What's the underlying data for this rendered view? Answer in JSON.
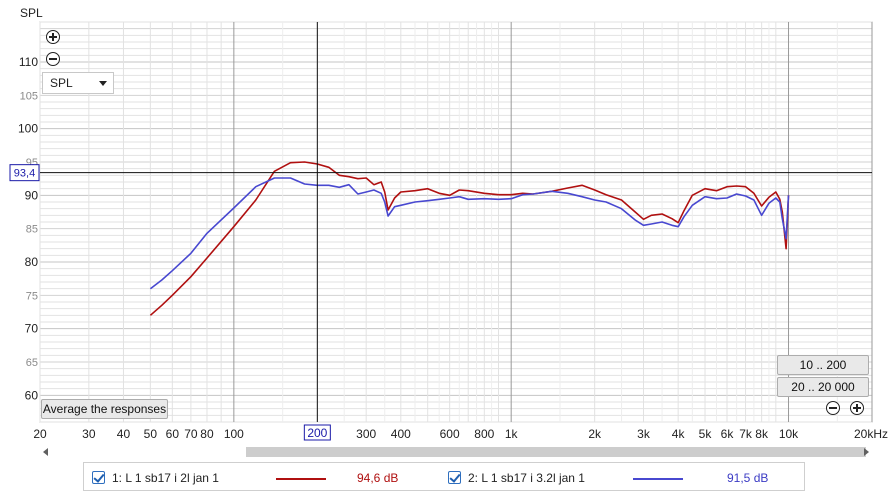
{
  "colors": {
    "series1": "#b01010",
    "series2": "#4848d0",
    "cursor": "#1a1aa8",
    "grid_major": "#c4c4c4",
    "grid_minor": "#e2e2e2"
  },
  "controls": {
    "select_value": "SPL",
    "average_button": "Average the responses",
    "range_button_1": "10 .. 200",
    "range_button_2": "20 .. 20 000",
    "zoom_in_icon": "plus-circle-icon",
    "zoom_out_icon": "minus-circle-icon"
  },
  "legend": [
    {
      "label": "1: L 1 sb17 i 2l jan 1",
      "value": "94,6 dB",
      "checked": true
    },
    {
      "label": "2: L 1 sb17 i 3.2l jan 1",
      "value": "91,5 dB",
      "checked": true
    }
  ],
  "chart_data": {
    "type": "line",
    "ylabel": "SPL",
    "xlabel": "",
    "x_scale": "log",
    "xlim": [
      20,
      20000
    ],
    "ylim": [
      56,
      116
    ],
    "grid": true,
    "y_ticks": [
      "60",
      "65",
      "70",
      "75",
      "80",
      "85",
      "90",
      "95",
      "100",
      "105",
      "110"
    ],
    "y_ticks_major": [
      60,
      70,
      80,
      90,
      100,
      110
    ],
    "x_ticks": [
      {
        "v": 20,
        "label": "20"
      },
      {
        "v": 30,
        "label": "30"
      },
      {
        "v": 40,
        "label": "40"
      },
      {
        "v": 50,
        "label": "50"
      },
      {
        "v": 60,
        "label": "60"
      },
      {
        "v": 70,
        "label": "70"
      },
      {
        "v": 80,
        "label": "80"
      },
      {
        "v": 100,
        "label": "100"
      },
      {
        "v": 200,
        "label": "200"
      },
      {
        "v": 300,
        "label": "300"
      },
      {
        "v": 400,
        "label": "400"
      },
      {
        "v": 600,
        "label": "600"
      },
      {
        "v": 800,
        "label": "800"
      },
      {
        "v": 1000,
        "label": "1k"
      },
      {
        "v": 2000,
        "label": "2k"
      },
      {
        "v": 3000,
        "label": "3k"
      },
      {
        "v": 4000,
        "label": "4k"
      },
      {
        "v": 5000,
        "label": "5k"
      },
      {
        "v": 6000,
        "label": "6k"
      },
      {
        "v": 7000,
        "label": "7k"
      },
      {
        "v": 8000,
        "label": "8k"
      },
      {
        "v": 10000,
        "label": "10k"
      },
      {
        "v": 20000,
        "label": "20kHz"
      }
    ],
    "cursor": {
      "x": 200,
      "y": 93.4,
      "x_label": "200",
      "y_label": "93,4"
    },
    "series": [
      {
        "name": "1: L 1 sb17 i 2l jan 1",
        "x": [
          50,
          55,
          60,
          70,
          80,
          100,
          120,
          140,
          160,
          180,
          200,
          220,
          240,
          260,
          280,
          300,
          320,
          340,
          350,
          360,
          380,
          400,
          450,
          500,
          550,
          600,
          650,
          700,
          800,
          900,
          1000,
          1100,
          1200,
          1400,
          1600,
          1800,
          2000,
          2200,
          2500,
          2800,
          3000,
          3200,
          3500,
          3800,
          4000,
          4200,
          4500,
          5000,
          5500,
          6000,
          6500,
          7000,
          7500,
          8000,
          8500,
          9000,
          9300,
          9500,
          9800,
          10000
        ],
        "y": [
          72,
          73.5,
          75,
          77.8,
          80.6,
          85.3,
          89.3,
          93.6,
          94.9,
          95,
          94.7,
          94.2,
          93,
          92.8,
          92.5,
          92.6,
          91.6,
          92,
          90.5,
          87.8,
          89.6,
          90.5,
          90.7,
          91,
          90.3,
          90,
          90.8,
          90.7,
          90.3,
          90.1,
          90.1,
          90.3,
          90.2,
          90.6,
          91.1,
          91.5,
          90.8,
          90.1,
          89.3,
          87.5,
          86.4,
          87,
          87.2,
          86.5,
          85.9,
          87.7,
          90,
          91,
          90.7,
          91.3,
          91.4,
          91.3,
          90.3,
          88.4,
          89.7,
          90.5,
          89.4,
          87.5,
          82,
          90
        ]
      },
      {
        "name": "2: L 1 sb17 i 3.2l jan 1",
        "x": [
          50,
          55,
          60,
          70,
          80,
          100,
          120,
          140,
          160,
          180,
          200,
          220,
          240,
          260,
          280,
          300,
          320,
          340,
          350,
          360,
          380,
          400,
          450,
          500,
          550,
          600,
          650,
          700,
          800,
          900,
          1000,
          1100,
          1200,
          1400,
          1600,
          1800,
          2000,
          2200,
          2500,
          2800,
          3000,
          3200,
          3500,
          3800,
          4000,
          4200,
          4500,
          5000,
          5500,
          6000,
          6500,
          7000,
          7500,
          8000,
          8500,
          9000,
          9300,
          9500,
          9800,
          10000
        ],
        "y": [
          76,
          77.3,
          78.7,
          81.3,
          84.3,
          88.1,
          91.3,
          92.6,
          92.6,
          91.7,
          91.5,
          91.5,
          91.2,
          91.6,
          90.2,
          90.5,
          90.8,
          90.3,
          89,
          86.9,
          88.3,
          88.5,
          89,
          89.2,
          89.4,
          89.6,
          89.8,
          89.4,
          89.5,
          89.4,
          89.5,
          90.1,
          90.2,
          90.6,
          90.3,
          89.8,
          89.3,
          89,
          88,
          86.3,
          85.5,
          85.7,
          86,
          85.5,
          85.3,
          86.8,
          88.5,
          89.8,
          89.5,
          89.6,
          90.2,
          89.9,
          89.3,
          87,
          88.8,
          89.6,
          89,
          86.5,
          83.5,
          90
        ]
      }
    ]
  }
}
